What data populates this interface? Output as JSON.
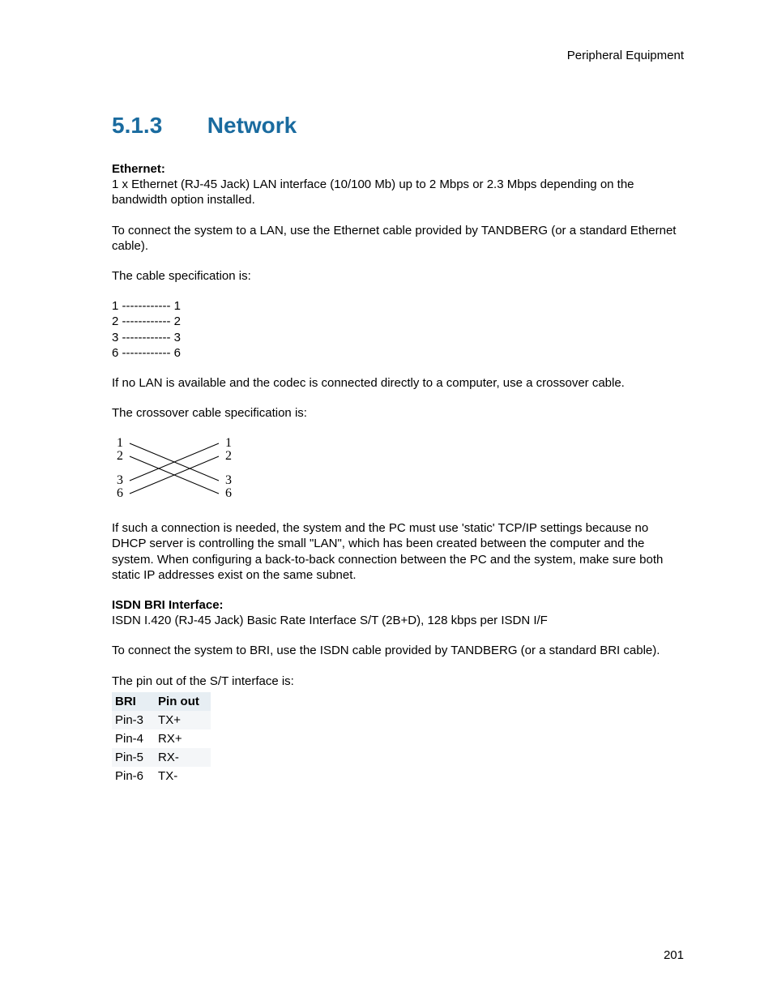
{
  "header": {
    "right": "Peripheral Equipment"
  },
  "heading": {
    "number": "5.1.3",
    "title": "Network"
  },
  "ethernet": {
    "label": "Ethernet:",
    "p1": "1 x Ethernet (RJ-45 Jack) LAN interface (10/100 Mb) up to 2 Mbps or 2.3 Mbps depending on the bandwidth option installed.",
    "p2": "To connect the system to a LAN, use the Ethernet cable provided by TANDBERG (or a standard Ethernet cable).",
    "p3": "The cable specification is:",
    "spec": [
      "1 ------------ 1",
      "2 ------------ 2",
      "3 ------------ 3",
      "6 ------------ 6"
    ],
    "p4": " If no LAN is available and the codec is connected directly to a computer, use a crossover cable.",
    "p5": "The crossover cable specification is:",
    "crossover": {
      "left": [
        "1",
        "2",
        "3",
        "6"
      ],
      "right": [
        "1",
        "2",
        "3",
        "6"
      ]
    },
    "p6": "If such a connection is needed, the system and the PC must use 'static' TCP/IP settings because no DHCP server is controlling the small \"LAN\", which has been created between the computer and the system. When configuring a back-to-back connection between the PC and the system, make sure both static IP addresses exist on the same subnet."
  },
  "isdn": {
    "label": "ISDN BRI Interface:",
    "p1": "ISDN I.420 (RJ-45 Jack) Basic Rate Interface S/T (2B+D), 128 kbps per ISDN I/F",
    "p2": "To connect the system to BRI, use the ISDN cable provided by TANDBERG (or a standard BRI cable).",
    "p3": "The pin out of the S/T interface is:",
    "table": {
      "headers": [
        "BRI",
        "Pin out"
      ],
      "rows": [
        [
          "Pin-3",
          "TX+"
        ],
        [
          "Pin-4",
          "RX+"
        ],
        [
          "Pin-5",
          "RX-"
        ],
        [
          "Pin-6",
          "TX-"
        ]
      ]
    }
  },
  "pageNumber": "201"
}
